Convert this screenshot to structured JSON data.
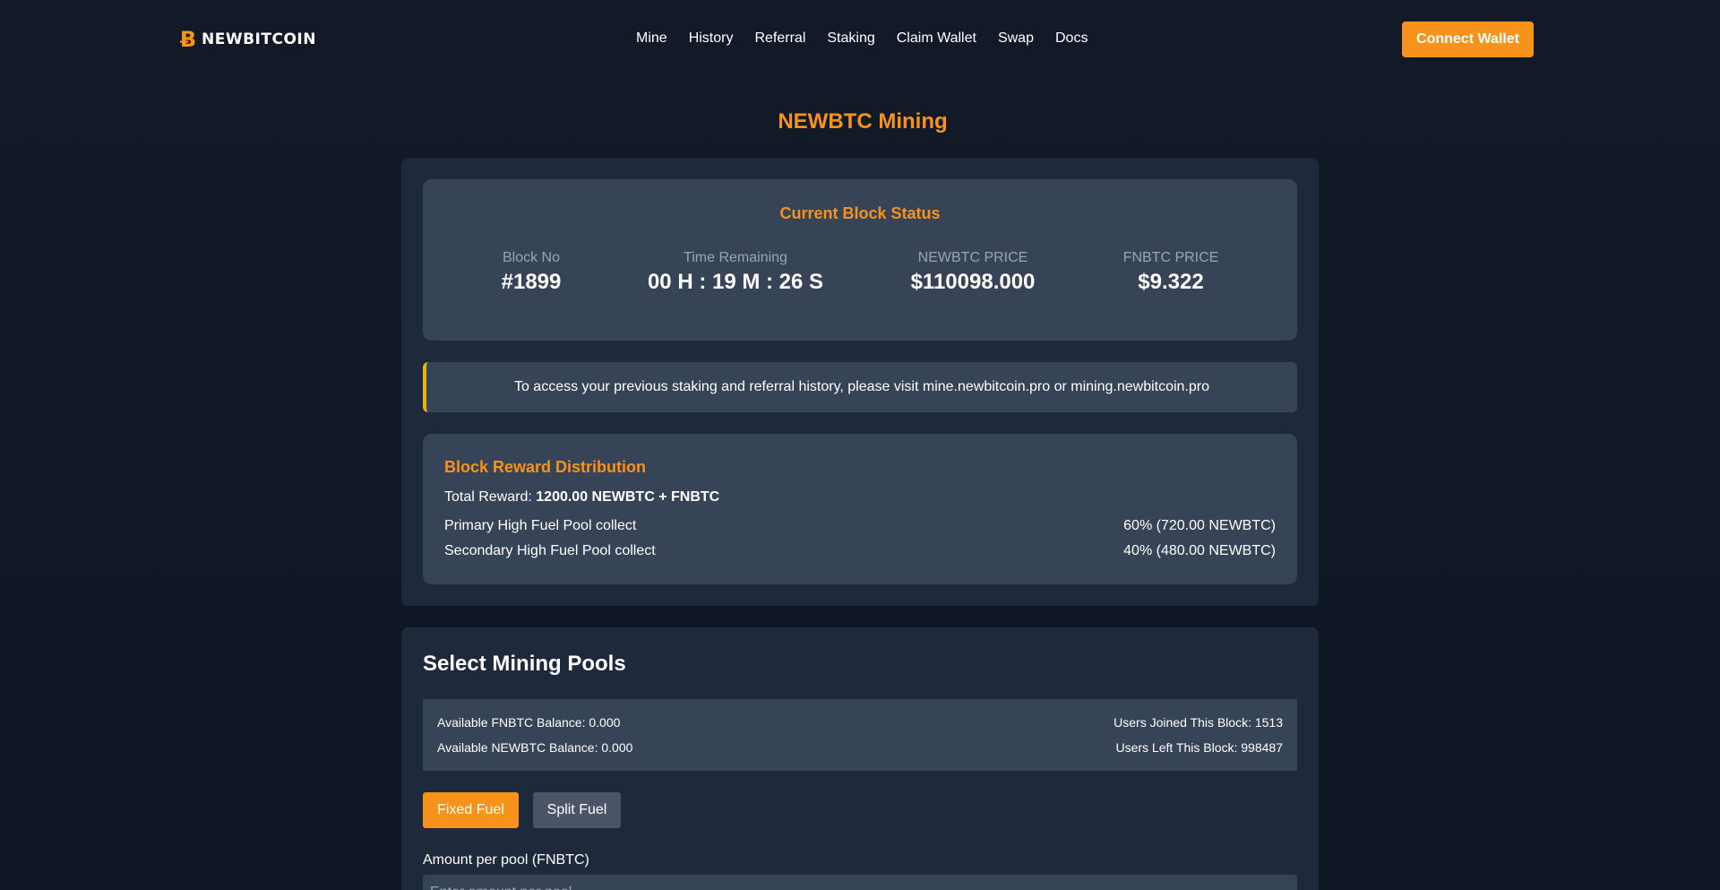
{
  "header": {
    "logo_text": "NEWBITCOIN",
    "logo_icon": "newbitcoin-logo-icon",
    "nav": [
      "Mine",
      "History",
      "Referral",
      "Staking",
      "Claim Wallet",
      "Swap",
      "Docs"
    ],
    "connect_label": "Connect Wallet"
  },
  "page": {
    "title_icon": "",
    "title": "NEWBTC Mining"
  },
  "status": {
    "title": "Current Block Status",
    "stats": [
      {
        "label": "Block No",
        "value": "#1899"
      },
      {
        "label": "Time Remaining",
        "value": "00 H : 19 M : 26 S"
      },
      {
        "label": "NEWBTC PRICE",
        "value": "$110098.000"
      },
      {
        "label": "FNBTC PRICE",
        "value": "$9.322"
      }
    ]
  },
  "notice": "To access your previous staking and referral history, please visit mine.newbitcoin.pro or mining.newbitcoin.pro",
  "reward": {
    "title": "Block Reward Distribution",
    "total_label": "Total Reward: ",
    "total_value": "1200.00 NEWBTC + FNBTC",
    "rows": [
      {
        "label": "Primary High Fuel Pool collect",
        "value": "60% (720.00 NEWBTC)"
      },
      {
        "label": "Secondary High Fuel Pool collect",
        "value": "40% (480.00 NEWBTC)"
      }
    ]
  },
  "pools": {
    "title": "Select Mining Pools",
    "fnbtc_balance": "Available FNBTC Balance: 0.000",
    "newbtc_balance": "Available NEWBTC Balance: 0.000",
    "users_joined": "Users Joined This Block: 1513",
    "users_left": "Users Left This Block: 998487",
    "fixed_label": "Fixed Fuel",
    "split_label": "Split Fuel",
    "amount_label": "Amount per pool (FNBTC)",
    "amount_placeholder": "Enter amount per pool"
  },
  "colors": {
    "accent": "#f7931a",
    "background": "#0f172a",
    "card": "#1e293b",
    "inner_card": "#374357",
    "notice_border": "#eab308"
  }
}
